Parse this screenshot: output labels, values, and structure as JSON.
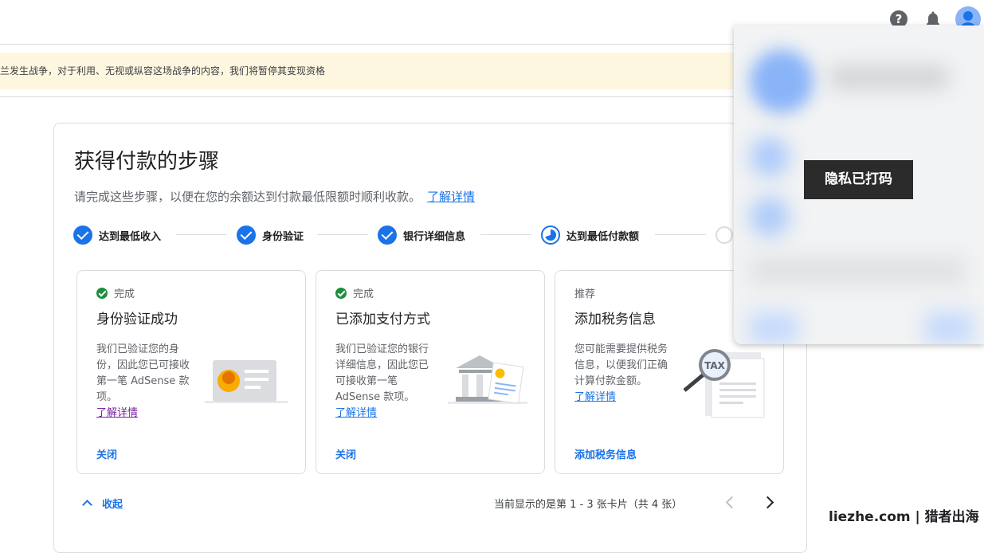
{
  "banner": {
    "text": "兰发生战争，对于利用、无视或纵容这场战争的内容，我们将暂停其变现资格"
  },
  "topbar": {
    "help_icon": "help-icon",
    "bell_icon": "notification-bell-icon",
    "avatar_icon": "account-avatar-icon"
  },
  "main": {
    "title": "获得付款的步骤",
    "subtitle": "请完成这些步骤，以便在您的余额达到付款最低限额时顺利收款。",
    "learn_more": "了解详情",
    "steps": [
      {
        "label": "达到最低收入",
        "state": "done"
      },
      {
        "label": "身份验证",
        "state": "done"
      },
      {
        "label": "银行详细信息",
        "state": "done"
      },
      {
        "label": "达到最低付款额",
        "state": "in-progress"
      },
      {
        "label": "",
        "state": "pending"
      }
    ],
    "cards": [
      {
        "status": "完成",
        "title": "身份验证成功",
        "desc": "我们已验证您的身份，因此您已可接收第一笔 AdSense 款项。",
        "more": "了解详情",
        "action": "关闭"
      },
      {
        "status": "完成",
        "title": "已添加支付方式",
        "desc": "我们已验证您的银行详细信息，因此您已可接收第一笔 AdSense 款项。",
        "more": "了解详情",
        "action": "关闭"
      },
      {
        "status": "推荐",
        "title": "添加税务信息",
        "desc": "您可能需要提供税务信息，以便我们正确计算付款金额。",
        "more": "了解详情",
        "action": "添加税务信息",
        "illus_text": "TAX"
      }
    ],
    "collapse": "收起",
    "pager": "当前显示的是第 1 - 3 张卡片（共 4 张）"
  },
  "overlay": {
    "privacy": "隐私已打码"
  },
  "watermark": "liezhe.com | 猎者出海",
  "colors": {
    "accent": "#1a73e8",
    "success": "#1e8e3e",
    "banner_bg": "#fef7e0"
  }
}
